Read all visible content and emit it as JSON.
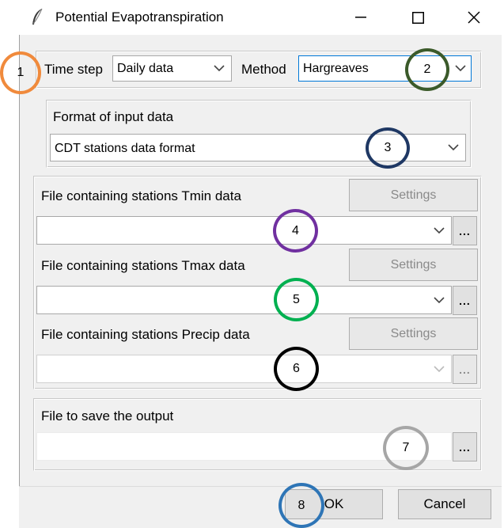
{
  "window": {
    "title": "Potential Evapotranspiration",
    "minimize": "—",
    "maximize": "☐",
    "close": "✕"
  },
  "top": {
    "timestep_label": "Time step",
    "timestep_value": "Daily data",
    "method_label": "Method",
    "method_value": "Hargreaves"
  },
  "format": {
    "label": "Format of input data",
    "value": "CDT stations data format"
  },
  "files": [
    {
      "label": "File containing stations Tmin data",
      "settings": "Settings",
      "value": "",
      "browse": "..."
    },
    {
      "label": "File containing stations Tmax data",
      "settings": "Settings",
      "value": "",
      "browse": "..."
    },
    {
      "label": "File containing stations Precip data",
      "settings": "Settings",
      "value": "",
      "browse": "..."
    }
  ],
  "output": {
    "label": "File to save the output",
    "value": "",
    "browse": "..."
  },
  "buttons": {
    "ok": "OK",
    "cancel": "Cancel"
  },
  "markers": [
    {
      "number": "1",
      "color": "#f08a3c"
    },
    {
      "number": "2",
      "color": "#3b5a2a"
    },
    {
      "number": "3",
      "color": "#1f3864"
    },
    {
      "number": "4",
      "color": "#7030a0"
    },
    {
      "number": "5",
      "color": "#00b050"
    },
    {
      "number": "6",
      "color": "#000000"
    },
    {
      "number": "7",
      "color": "#a6a6a6"
    },
    {
      "number": "8",
      "color": "#2e75b6"
    }
  ]
}
